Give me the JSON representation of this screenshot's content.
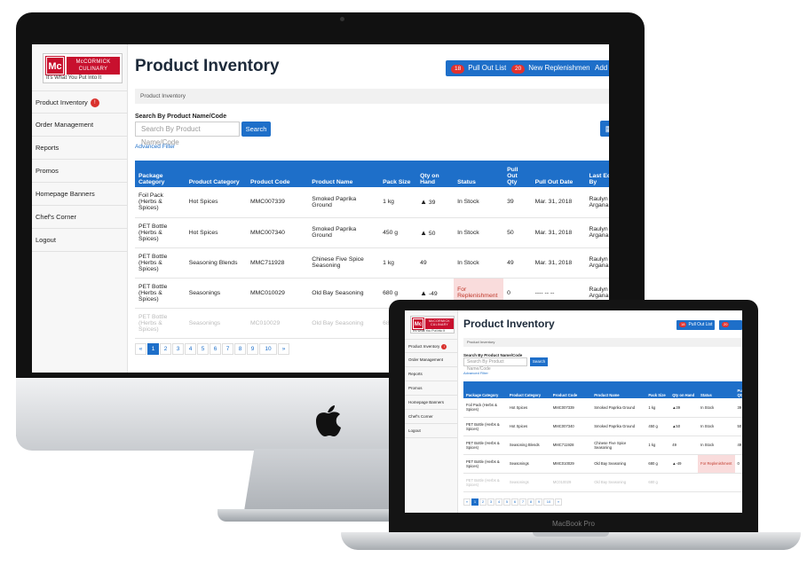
{
  "app": {
    "title": "Product Inventory",
    "logo_brand": "McCORMICK CULINARY",
    "logo_tagline": "It's What You Put Into It",
    "logo_mark": "Mc"
  },
  "sidebar": {
    "items": [
      {
        "label": "Product Inventory",
        "badge": "!"
      },
      {
        "label": "Order Management"
      },
      {
        "label": "Reports"
      },
      {
        "label": "Promos"
      },
      {
        "label": "Homepage Banners"
      },
      {
        "label": "Chef's Corner"
      },
      {
        "label": "Logout"
      }
    ]
  },
  "header": {
    "pull_out_count": "18",
    "pull_out_label": "Pull Out List",
    "replenishment_count": "20",
    "replenishment_label": "New Replenishment",
    "add_new_label": "Add New"
  },
  "breadcrumb": "Product Inventory",
  "search": {
    "label": "Search By Product Name/Code",
    "placeholder": "Search By Product Name/Code",
    "button": "Search",
    "advanced": "Advanced Filter"
  },
  "table": {
    "columns": [
      "Package Category",
      "Product Category",
      "Product Code",
      "Product Name",
      "Pack Size",
      "Qty on Hand",
      "Status",
      "Pull Out Qty",
      "Pull Out Date",
      "Last Edited By"
    ],
    "rows": [
      {
        "pkg": "Foil Pack (Herbs & Spices)",
        "cat": "Hot Spices",
        "code": "MMC007339",
        "name": "Smoked Paprika Ground",
        "size": "1 kg",
        "qty": "39",
        "warn": true,
        "status": "In Stock",
        "pull_qty": "39",
        "date": "Mar. 31, 2018",
        "edited": "Raulyn Argana"
      },
      {
        "pkg": "PET Bottle (Herbs & Spices)",
        "cat": "Hot Spices",
        "code": "MMC007340",
        "name": "Smoked Paprika Ground",
        "size": "450 g",
        "qty": "50",
        "warn": true,
        "status": "In Stock",
        "pull_qty": "50",
        "date": "Mar. 31, 2018",
        "edited": "Raulyn Argana"
      },
      {
        "pkg": "PET Bottle (Herbs & Spices)",
        "cat": "Seasoning Blends",
        "code": "MMC711928",
        "name": "Chinese Five Spice Seasoning",
        "size": "1 kg",
        "qty": "49",
        "warn": false,
        "status": "In Stock",
        "pull_qty": "49",
        "date": "Mar. 31, 2018",
        "edited": "Raulyn Argana"
      },
      {
        "pkg": "PET Bottle (Herbs & Spices)",
        "cat": "Seasonings",
        "code": "MMC010029",
        "name": "Old Bay Seasoning",
        "size": "680 g",
        "qty": "-49",
        "warn": true,
        "status": "For Replenishment",
        "pull_qty": "0",
        "date": "---- -- --",
        "edited": "Raulyn Argana"
      },
      {
        "pkg": "PET Bottle (Herbs & Spices)",
        "cat": "Seasonings",
        "code": "MC010029",
        "name": "Old Bay Seasoning",
        "size": "680 g",
        "qty": "",
        "warn": false,
        "status": "",
        "pull_qty": "",
        "date": "",
        "edited": ""
      }
    ]
  },
  "pagination": [
    "«",
    "1",
    "2",
    "3",
    "4",
    "5",
    "6",
    "7",
    "8",
    "9",
    "10",
    "»"
  ],
  "laptop_label": "MacBook Pro"
}
